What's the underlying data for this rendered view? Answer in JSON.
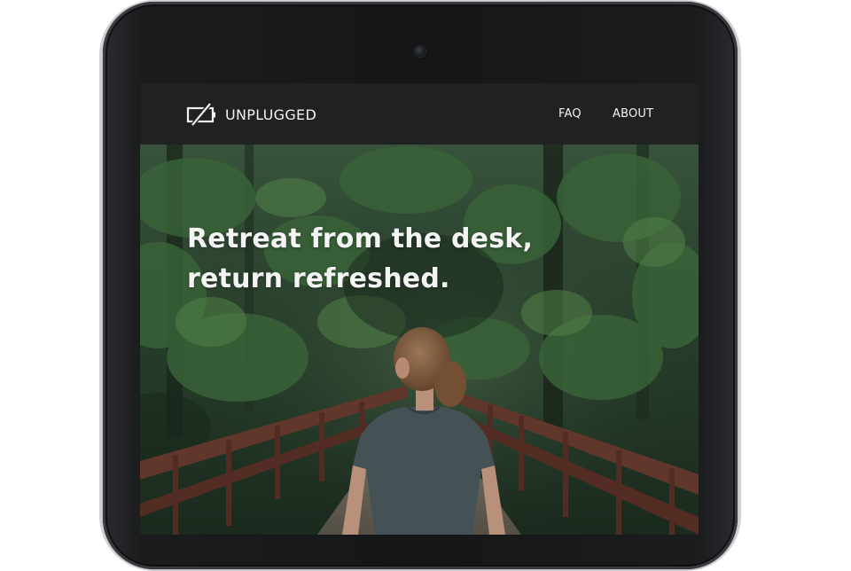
{
  "brand": {
    "name": "UNPLUGGED",
    "logo_icon": "battery-slash-icon"
  },
  "nav": {
    "links": [
      {
        "label": "FAQ"
      },
      {
        "label": "ABOUT"
      }
    ]
  },
  "hero": {
    "headline_line1": "Retreat from the desk,",
    "headline_line2": "return refreshed.",
    "image": "woman-on-forest-bridge-photo"
  },
  "colors": {
    "navbar_bg": "#1f2123",
    "text": "#f2f2f2",
    "forest": "#2f4a33",
    "bridge_rail": "#6a3b2f",
    "device_frame": "#151618"
  }
}
